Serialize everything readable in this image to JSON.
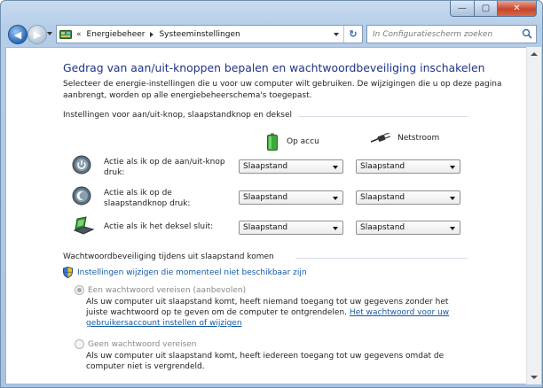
{
  "window": {
    "controls": {
      "minimize": "—",
      "maximize": "▢",
      "close": "✕"
    }
  },
  "nav": {
    "back_icon": "back-arrow-icon",
    "forward_icon": "forward-arrow-icon",
    "back_glyph": "◀",
    "forward_glyph": "▶",
    "address": {
      "overflow": "«",
      "crumbs": [
        "Energiebeheer",
        "Systeeminstellingen"
      ],
      "refresh_glyph": "↻"
    },
    "search": {
      "placeholder": "In Configuratiescherm zoeken"
    }
  },
  "page": {
    "title": "Gedrag van aan/uit-knoppen bepalen en wachtwoordbeveiliging inschakelen",
    "intro": "Selecteer de energie-instellingen die u voor uw computer wilt gebruiken. De wijzigingen die u op deze pagina aanbrengt, worden op alle energiebeheerschema's toegepast.",
    "section_buttons": {
      "heading": "Instellingen voor aan/uit-knop, slaapstandknop en deksel",
      "col_battery": "Op accu",
      "col_ac": "Netstroom",
      "rows": [
        {
          "label": "Actie als ik op de aan/uit-knop druk:",
          "battery": "Slaapstand",
          "ac": "Slaapstand",
          "icon": "power-button-icon"
        },
        {
          "label": "Actie als ik op de slaapstandknop druk:",
          "battery": "Slaapstand",
          "ac": "Slaapstand",
          "icon": "sleep-button-icon"
        },
        {
          "label": "Actie als ik het deksel sluit:",
          "battery": "Slaapstand",
          "ac": "Slaapstand",
          "icon": "laptop-lid-icon"
        }
      ]
    },
    "section_password": {
      "heading": "Wachtwoordbeveiliging tijdens uit slaapstand komen",
      "change_link": "Instellingen wijzigen die momenteel niet beschikbaar zijn",
      "options": [
        {
          "label": "Een wachtwoord vereisen (aanbevolen)",
          "selected": true,
          "desc": "Als uw computer uit slaapstand komt, heeft niemand toegang tot uw gegevens zonder het juiste wachtwoord op te geven om de computer te ontgrendelen.",
          "link": "Het wachtwoord voor uw gebruikersaccount instellen of wijzigen"
        },
        {
          "label": "Geen wachtwoord vereisen",
          "selected": false,
          "desc": "Als uw computer uit slaapstand komt, heeft iedereen toegang tot uw gegevens omdat de computer niet is vergrendeld."
        }
      ]
    }
  },
  "colors": {
    "title": "#1e3287",
    "link": "#1559a8",
    "window_frame": "#b4cde8"
  }
}
